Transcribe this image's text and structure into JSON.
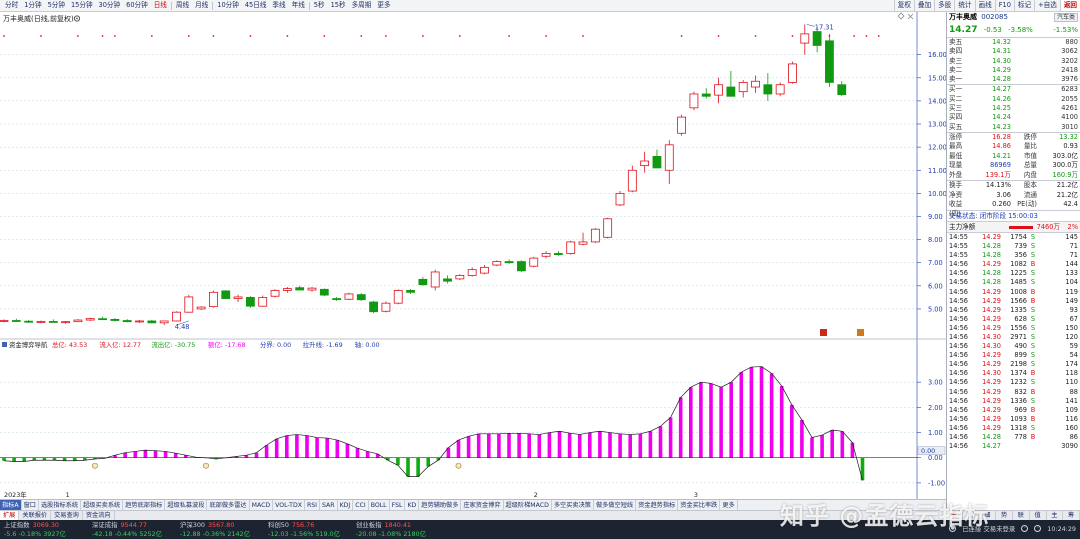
{
  "colors": {
    "up": "#e0101a",
    "down": "#119911",
    "flow_pos": "#ee00ee",
    "flow_neg": "#11aa11",
    "grid": "#b9d6e6",
    "axis": "#1e3cb0"
  },
  "toolbar": {
    "period_tabs": [
      "分时",
      "1分钟",
      "5分钟",
      "15分钟",
      "30分钟",
      "60分钟",
      "日线",
      "周线",
      "月线",
      "10分钟",
      "45日线",
      "季线",
      "年线",
      "5秒",
      "15秒",
      "多周期",
      "更多"
    ],
    "active_period": "日线",
    "right_tools": [
      "复权",
      "叠加",
      "多股",
      "统计",
      "画线",
      "F10",
      "标记",
      "+自选",
      "返回"
    ],
    "active_tool": "返回"
  },
  "chart_header": {
    "title": "万丰奥威(日线,前复权)",
    "settings_icon": "gear-icon"
  },
  "price_axis": {
    "labels": [
      "16.00",
      "15.00",
      "14.00",
      "13.00",
      "12.00",
      "11.00",
      "10.00",
      "9.00",
      "8.00",
      "7.00",
      "6.00",
      "5.00"
    ],
    "values": [
      16,
      15,
      14,
      13,
      12,
      11,
      10,
      9,
      8,
      7,
      6,
      5
    ],
    "min": 3.7,
    "max": 17.5
  },
  "annotations": {
    "high_label": "17.31",
    "low_label": "4.48",
    "high_value": 17.31,
    "low_value": 4.48
  },
  "candles": [
    {
      "o": 4.48,
      "h": 4.55,
      "l": 4.42,
      "c": 4.5
    },
    {
      "o": 4.5,
      "h": 4.58,
      "l": 4.45,
      "c": 4.47
    },
    {
      "o": 4.47,
      "h": 4.52,
      "l": 4.4,
      "c": 4.44
    },
    {
      "o": 4.44,
      "h": 4.5,
      "l": 4.38,
      "c": 4.46
    },
    {
      "o": 4.46,
      "h": 4.55,
      "l": 4.42,
      "c": 4.42
    },
    {
      "o": 4.42,
      "h": 4.48,
      "l": 4.36,
      "c": 4.45
    },
    {
      "o": 4.45,
      "h": 4.56,
      "l": 4.43,
      "c": 4.52
    },
    {
      "o": 4.52,
      "h": 4.62,
      "l": 4.48,
      "c": 4.58
    },
    {
      "o": 4.58,
      "h": 4.66,
      "l": 4.52,
      "c": 4.55
    },
    {
      "o": 4.55,
      "h": 4.6,
      "l": 4.46,
      "c": 4.5
    },
    {
      "o": 4.5,
      "h": 4.56,
      "l": 4.42,
      "c": 4.45
    },
    {
      "o": 4.45,
      "h": 4.52,
      "l": 4.4,
      "c": 4.48
    },
    {
      "o": 4.48,
      "h": 4.53,
      "l": 4.38,
      "c": 4.4
    },
    {
      "o": 4.4,
      "h": 4.46,
      "l": 4.3,
      "c": 4.48
    },
    {
      "o": 4.48,
      "h": 4.9,
      "l": 4.46,
      "c": 4.86
    },
    {
      "o": 4.86,
      "h": 5.6,
      "l": 4.84,
      "c": 5.52
    },
    {
      "o": 5.0,
      "h": 5.12,
      "l": 4.95,
      "c": 5.08
    },
    {
      "o": 5.1,
      "h": 5.8,
      "l": 5.05,
      "c": 5.72
    },
    {
      "o": 5.78,
      "h": 5.82,
      "l": 5.42,
      "c": 5.45
    },
    {
      "o": 5.45,
      "h": 5.62,
      "l": 5.3,
      "c": 5.52
    },
    {
      "o": 5.5,
      "h": 5.55,
      "l": 5.05,
      "c": 5.12
    },
    {
      "o": 5.12,
      "h": 5.58,
      "l": 5.1,
      "c": 5.5
    },
    {
      "o": 5.55,
      "h": 5.85,
      "l": 5.5,
      "c": 5.8
    },
    {
      "o": 5.8,
      "h": 5.95,
      "l": 5.7,
      "c": 5.88
    },
    {
      "o": 5.92,
      "h": 6.0,
      "l": 5.8,
      "c": 5.82
    },
    {
      "o": 5.82,
      "h": 5.95,
      "l": 5.75,
      "c": 5.9
    },
    {
      "o": 5.85,
      "h": 5.88,
      "l": 5.55,
      "c": 5.6
    },
    {
      "o": 5.45,
      "h": 5.52,
      "l": 5.35,
      "c": 5.42
    },
    {
      "o": 5.42,
      "h": 5.7,
      "l": 5.38,
      "c": 5.65
    },
    {
      "o": 5.62,
      "h": 5.68,
      "l": 5.35,
      "c": 5.4
    },
    {
      "o": 5.3,
      "h": 5.35,
      "l": 4.82,
      "c": 4.88
    },
    {
      "o": 4.9,
      "h": 5.32,
      "l": 4.85,
      "c": 5.25
    },
    {
      "o": 5.25,
      "h": 5.85,
      "l": 5.2,
      "c": 5.8
    },
    {
      "o": 5.8,
      "h": 5.86,
      "l": 5.65,
      "c": 5.72
    },
    {
      "o": 6.28,
      "h": 6.38,
      "l": 6.0,
      "c": 6.05
    },
    {
      "o": 5.95,
      "h": 6.7,
      "l": 5.8,
      "c": 6.6
    },
    {
      "o": 6.3,
      "h": 6.45,
      "l": 6.1,
      "c": 6.2
    },
    {
      "o": 6.3,
      "h": 6.5,
      "l": 6.25,
      "c": 6.45
    },
    {
      "o": 6.45,
      "h": 6.8,
      "l": 6.4,
      "c": 6.7
    },
    {
      "o": 6.55,
      "h": 6.9,
      "l": 6.5,
      "c": 6.8
    },
    {
      "o": 6.9,
      "h": 7.1,
      "l": 6.85,
      "c": 7.05
    },
    {
      "o": 7.05,
      "h": 7.15,
      "l": 6.95,
      "c": 7.0
    },
    {
      "o": 7.05,
      "h": 7.1,
      "l": 6.6,
      "c": 6.65
    },
    {
      "o": 6.85,
      "h": 7.25,
      "l": 6.8,
      "c": 7.2
    },
    {
      "o": 7.28,
      "h": 7.5,
      "l": 7.2,
      "c": 7.4
    },
    {
      "o": 7.4,
      "h": 7.5,
      "l": 7.3,
      "c": 7.35
    },
    {
      "o": 7.4,
      "h": 7.95,
      "l": 7.35,
      "c": 7.9
    },
    {
      "o": 7.8,
      "h": 8.3,
      "l": 7.75,
      "c": 7.9
    },
    {
      "o": 7.9,
      "h": 8.5,
      "l": 7.85,
      "c": 8.45
    },
    {
      "o": 8.1,
      "h": 8.95,
      "l": 8.05,
      "c": 8.9
    },
    {
      "o": 9.5,
      "h": 10.1,
      "l": 9.45,
      "c": 10.0
    },
    {
      "o": 10.1,
      "h": 11.2,
      "l": 10.05,
      "c": 11.0
    },
    {
      "o": 11.2,
      "h": 11.8,
      "l": 10.9,
      "c": 11.4
    },
    {
      "o": 11.6,
      "h": 11.9,
      "l": 11.2,
      "c": 11.1
    },
    {
      "o": 11.0,
      "h": 12.3,
      "l": 10.4,
      "c": 12.1
    },
    {
      "o": 12.6,
      "h": 13.4,
      "l": 12.5,
      "c": 13.3
    },
    {
      "o": 13.7,
      "h": 14.4,
      "l": 13.6,
      "c": 14.3
    },
    {
      "o": 14.3,
      "h": 14.55,
      "l": 14.1,
      "c": 14.2
    },
    {
      "o": 14.25,
      "h": 15.0,
      "l": 13.9,
      "c": 14.7
    },
    {
      "o": 14.6,
      "h": 15.3,
      "l": 14.2,
      "c": 14.2
    },
    {
      "o": 14.4,
      "h": 14.9,
      "l": 14.15,
      "c": 14.8
    },
    {
      "o": 14.6,
      "h": 15.1,
      "l": 14.35,
      "c": 14.85
    },
    {
      "o": 14.7,
      "h": 15.2,
      "l": 14.0,
      "c": 14.3
    },
    {
      "o": 14.3,
      "h": 14.8,
      "l": 14.2,
      "c": 14.7
    },
    {
      "o": 14.8,
      "h": 15.7,
      "l": 14.75,
      "c": 15.6
    },
    {
      "o": 16.5,
      "h": 17.31,
      "l": 16.0,
      "c": 16.9
    },
    {
      "o": 17.0,
      "h": 17.2,
      "l": 16.1,
      "c": 16.4
    },
    {
      "o": 16.6,
      "h": 16.9,
      "l": 14.6,
      "c": 14.8
    },
    {
      "o": 14.7,
      "h": 14.86,
      "l": 14.21,
      "c": 14.27
    }
  ],
  "markers_top": [
    0,
    3,
    6,
    8,
    9,
    12,
    15,
    17,
    20,
    23,
    26,
    29,
    31,
    34,
    37,
    41,
    44,
    47,
    55,
    58,
    61,
    64,
    66,
    67,
    69,
    70,
    71
  ],
  "flow_indicator": {
    "name": "资金博弈导航",
    "legend": [
      {
        "label": "总亿: 43.53",
        "color": "#e0101a"
      },
      {
        "label": "流入亿: 12.77",
        "color": "#e0101a"
      },
      {
        "label": "流出亿: -30.75",
        "color": "#119911"
      },
      {
        "label": "额亿: -17.68",
        "color": "#ee00ee"
      },
      {
        "label": "分界: 0.00",
        "color": "#1e3cb0"
      },
      {
        "label": "拉升线: -1.69",
        "color": "#1e3cb0"
      },
      {
        "label": "轴: 0.00",
        "color": "#1e3cb0"
      }
    ],
    "axis_labels": [
      "3.00",
      "2.00",
      "1.00",
      "0.00",
      "-1.00"
    ],
    "axis_values": [
      3,
      2,
      1,
      0,
      -1
    ],
    "min": -1.6,
    "max": 4.0,
    "current_label": "0.00",
    "values": [
      -0.12,
      -0.15,
      -0.15,
      -0.1,
      -0.1,
      -0.1,
      -0.12,
      -0.12,
      -0.1,
      -0.05,
      -0.02,
      0.1,
      0.2,
      0.25,
      0.3,
      0.28,
      0.25,
      0.18,
      0.1,
      0.02,
      0.0,
      -0.05,
      0.0,
      0.05,
      0.1,
      0.2,
      0.5,
      0.75,
      0.88,
      0.92,
      0.88,
      0.8,
      0.78,
      0.7,
      0.55,
      0.38,
      0.25,
      0.15,
      -0.1,
      -0.3,
      -0.75,
      -0.75,
      -0.35,
      -0.1,
      0.4,
      0.7,
      0.85,
      0.95,
      0.95,
      0.95,
      0.97,
      0.97,
      0.95,
      0.92,
      1.0,
      1.05,
      0.98,
      0.92,
      1.0,
      1.05,
      1.0,
      0.95,
      0.92,
      0.95,
      1.05,
      1.25,
      1.6,
      2.4,
      2.8,
      3.0,
      2.95,
      2.8,
      3.0,
      3.4,
      3.6,
      3.62,
      3.35,
      2.85,
      2.1,
      1.5,
      0.8,
      0.9,
      1.1,
      1.05,
      0.6,
      -0.9
    ]
  },
  "date_axis": [
    {
      "label": "2023年",
      "index": 0
    },
    {
      "label": "1",
      "index": 5
    },
    {
      "label": "2",
      "index": 43
    },
    {
      "label": "3",
      "index": 56
    }
  ],
  "indicator_tabs": [
    "指标A",
    "窗口",
    "选股指标系统",
    "超级买卖系统",
    "趋势底部指标",
    "超级私募波段",
    "底部做多雷达",
    "MACD",
    "VOL-TDX",
    "RSI",
    "SAR",
    "KDJ",
    "CCI",
    "BOLL",
    "FSL",
    "KD",
    "趋势辅助做多",
    "庄家资金博弈",
    "超级阶梯MACD",
    "多空买卖决策",
    "做多做空短线",
    "资金趋势指标",
    "资金买比率跌",
    "更多"
  ],
  "active_indicator": "指标A",
  "sub_tabs": [
    "扩展",
    "关联报价",
    "交易查询",
    "资金流向"
  ],
  "active_sub_tab": "扩展",
  "quote": {
    "name": "万丰奥威",
    "code": "002085",
    "industry": "汽车类",
    "price": "14.27",
    "change": "-0.53",
    "change_pct": "-3.58%",
    "rt_change": "-1.53%",
    "asks": [
      {
        "label": "卖五",
        "price": "14.32",
        "vol": "880"
      },
      {
        "label": "卖四",
        "price": "14.31",
        "vol": "3062"
      },
      {
        "label": "卖三",
        "price": "14.30",
        "vol": "3202"
      },
      {
        "label": "卖二",
        "price": "14.29",
        "vol": "2418"
      },
      {
        "label": "卖一",
        "price": "14.28",
        "vol": "3976"
      }
    ],
    "bids": [
      {
        "label": "买一",
        "price": "14.27",
        "vol": "6283"
      },
      {
        "label": "买二",
        "price": "14.26",
        "vol": "2055"
      },
      {
        "label": "买三",
        "price": "14.25",
        "vol": "4261"
      },
      {
        "label": "买四",
        "price": "14.24",
        "vol": "4100"
      },
      {
        "label": "买五",
        "price": "14.23",
        "vol": "3010"
      }
    ],
    "stats": [
      {
        "a": "涨停",
        "b": "16.28",
        "bc": "r",
        "c": "跌停",
        "d": "13.32",
        "dc": "g"
      },
      {
        "a": "最高",
        "b": "14.86",
        "bc": "r",
        "c": "量比",
        "d": "0.93",
        "dc": "bk"
      },
      {
        "a": "最低",
        "b": "14.21",
        "bc": "g",
        "c": "市值",
        "d": "303.0亿",
        "dc": "bk"
      },
      {
        "a": "现量",
        "b": "86969",
        "bc": "bl",
        "c": "总量",
        "d": "300.0万",
        "dc": "bk"
      },
      {
        "a": "外盘",
        "b": "139.1万",
        "bc": "r",
        "c": "内盘",
        "d": "160.9万",
        "dc": "g"
      }
    ],
    "stats2": [
      {
        "a": "换手",
        "b": "14.13%",
        "bc": "bk",
        "c": "股本",
        "d": "21.2亿",
        "dc": "bk"
      },
      {
        "a": "净资",
        "b": "3.06",
        "bc": "bk",
        "c": "流通",
        "d": "21.2亿",
        "dc": "bk"
      },
      {
        "a": "收益(四)",
        "b": "0.260",
        "bc": "bk",
        "c": "PE(动)",
        "d": "42.4",
        "dc": "bk"
      }
    ],
    "trade_status": "交易状态: 闭市阶段 15:00:03",
    "main_flow": {
      "label": "主力净额",
      "value": "7460万",
      "pct": "2%"
    },
    "ticks": [
      {
        "t": "14:55",
        "p": "14.29",
        "v": "1754",
        "s": "S",
        "n": "145"
      },
      {
        "t": "14:55",
        "p": "14.28",
        "v": "739",
        "s": "S",
        "n": "71"
      },
      {
        "t": "14:55",
        "p": "14.28",
        "v": "356",
        "s": "S",
        "n": "71"
      },
      {
        "t": "14:56",
        "p": "14.29",
        "v": "1082",
        "s": "B",
        "n": "144"
      },
      {
        "t": "14:56",
        "p": "14.28",
        "v": "1225",
        "s": "S",
        "n": "133"
      },
      {
        "t": "14:56",
        "p": "14.28",
        "v": "1485",
        "s": "S",
        "n": "104"
      },
      {
        "t": "14:56",
        "p": "14.29",
        "v": "1008",
        "s": "B",
        "n": "119"
      },
      {
        "t": "14:56",
        "p": "14.29",
        "v": "1566",
        "s": "B",
        "n": "149"
      },
      {
        "t": "14:56",
        "p": "14.29",
        "v": "1335",
        "s": "S",
        "n": "93"
      },
      {
        "t": "14:56",
        "p": "14.29",
        "v": "628",
        "s": "S",
        "n": "67"
      },
      {
        "t": "14:56",
        "p": "14.29",
        "v": "1556",
        "s": "S",
        "n": "150"
      },
      {
        "t": "14:56",
        "p": "14.30",
        "v": "2971",
        "s": "S",
        "n": "120"
      },
      {
        "t": "14:56",
        "p": "14.30",
        "v": "490",
        "s": "S",
        "n": "59"
      },
      {
        "t": "14:56",
        "p": "14.29",
        "v": "899",
        "s": "S",
        "n": "54"
      },
      {
        "t": "14:56",
        "p": "14.29",
        "v": "2198",
        "s": "S",
        "n": "174"
      },
      {
        "t": "14:56",
        "p": "14.30",
        "v": "1374",
        "s": "B",
        "n": "118"
      },
      {
        "t": "14:56",
        "p": "14.29",
        "v": "1232",
        "s": "S",
        "n": "110"
      },
      {
        "t": "14:56",
        "p": "14.29",
        "v": "832",
        "s": "B",
        "n": "88"
      },
      {
        "t": "14:56",
        "p": "14.29",
        "v": "1336",
        "s": "S",
        "n": "141"
      },
      {
        "t": "14:56",
        "p": "14.29",
        "v": "969",
        "s": "B",
        "n": "109"
      },
      {
        "t": "14:56",
        "p": "14.29",
        "v": "1093",
        "s": "B",
        "n": "116"
      },
      {
        "t": "14:56",
        "p": "14.29",
        "v": "1318",
        "s": "S",
        "n": "160"
      },
      {
        "t": "14:56",
        "p": "14.28",
        "v": "778",
        "s": "B",
        "n": "86"
      },
      {
        "t": "14:56",
        "p": "14.27",
        "v": "",
        "s": "",
        "n": "3090"
      }
    ],
    "panel_tabs": [
      "笔",
      "价",
      "细",
      "势",
      "联",
      "值",
      "主",
      "筹"
    ],
    "active_panel_tab": "笔"
  },
  "indices": [
    {
      "name": "上证指数",
      "value": "3069.30",
      "change": "-5.6",
      "pct": "-0.18%",
      "amount": "3927亿",
      "down": true
    },
    {
      "name": "深证成指",
      "value": "9544.77",
      "change": "-42.18",
      "pct": "-0.44%",
      "amount": "5252亿",
      "down": true
    },
    {
      "name": "沪深300",
      "value": "3567.80",
      "change": "-12.88",
      "pct": "-0.36%",
      "amount": "2142亿",
      "down": true
    },
    {
      "name": "科创50",
      "value": "756.76",
      "change": "-12.03",
      "pct": "-1.56%",
      "amount": "519.0亿",
      "down": true
    },
    {
      "name": "创业板指",
      "value": "1840.41",
      "change": "-20.08",
      "pct": "-1.08%",
      "amount": "2180亿",
      "down": true
    }
  ],
  "status_right": {
    "connection": "已连接 交易未登录",
    "time": "10:24:29"
  },
  "watermark": "知乎 @孟德云指标"
}
